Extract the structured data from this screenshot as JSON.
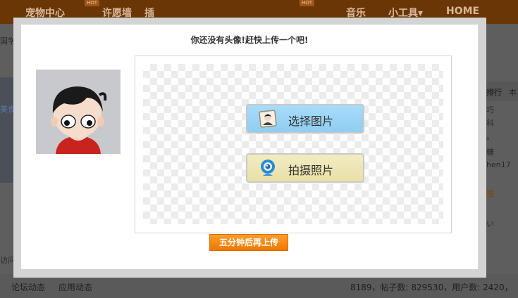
{
  "colors": {
    "accent_orange": "#f07800",
    "select_button": "#9dd6f6",
    "photo_button": "#ede5b4",
    "topbar": "#6a3605"
  },
  "nav": {
    "items": [
      "宠物中心",
      "许愿墙",
      "插",
      "音乐",
      "小工具",
      "HOME"
    ],
    "hot_badges": [
      "HOT",
      "HOT"
    ],
    "tool_arrow": "▾"
  },
  "background": {
    "left_labels": [
      "国学",
      "美食",
      "访问"
    ],
    "right_list_header": [
      "排行",
      "本"
    ],
    "right_list": [
      "巧",
      "科",
      "。",
      "糖",
      "hen17",
      "福",
      "い"
    ],
    "bottom_links": [
      "论坛动态",
      "应用动态"
    ],
    "stats": "8189，帖子数: 829530，用户数: 2420，"
  },
  "modal": {
    "title": "你还没有头像!赶快上传一个吧!",
    "select_label": "选择图片",
    "photo_label": "拍摄照片",
    "later_label": "五分钟后再上传"
  }
}
